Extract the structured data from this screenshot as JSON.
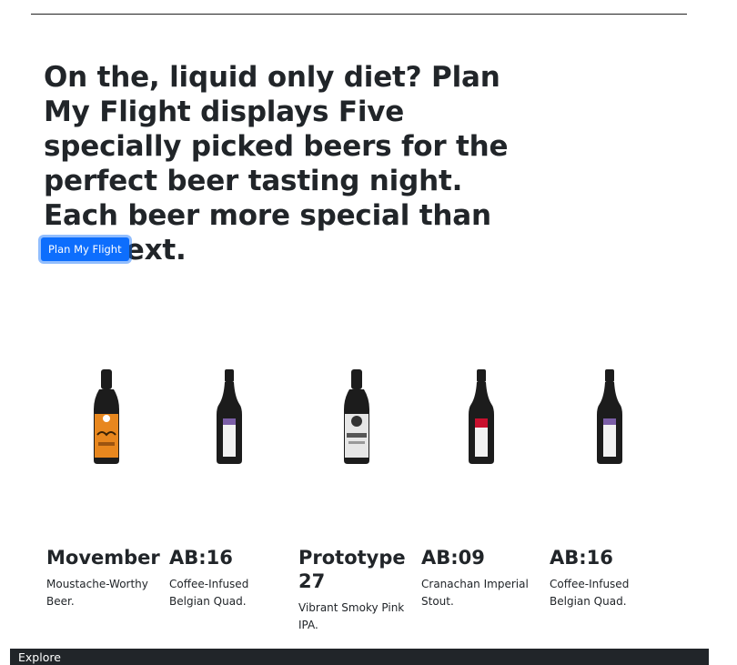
{
  "hero": {
    "title": "On the, liquid only diet? Plan My Flight displays Five specially picked beers for the perfect beer tasting night. Each beer more special than the next.",
    "button_label": "Plan My Flight"
  },
  "beers": [
    {
      "name": "Movember",
      "description": "Moustache-Worthy Beer.",
      "label_color": "#e8871e",
      "bottle_style": "stubby"
    },
    {
      "name": "AB:16",
      "description": "Coffee-Infused Belgian Quad.",
      "label_color": "#7b5ea7",
      "bottle_style": "tall"
    },
    {
      "name": "Prototype 27",
      "description": "Vibrant Smoky Pink IPA.",
      "label_color": "#e6e6e6",
      "bottle_style": "stubby"
    },
    {
      "name": "AB:09",
      "description": "Cranachan Imperial Stout.",
      "label_color": "#c8102e",
      "bottle_style": "tall"
    },
    {
      "name": "AB:16",
      "description": "Coffee-Infused Belgian Quad.",
      "label_color": "#7b5ea7",
      "bottle_style": "tall"
    }
  ],
  "footer": {
    "label": "Explore"
  },
  "colors": {
    "accent": "#0d6efd",
    "footer_bg": "#212529",
    "text": "#212529"
  }
}
